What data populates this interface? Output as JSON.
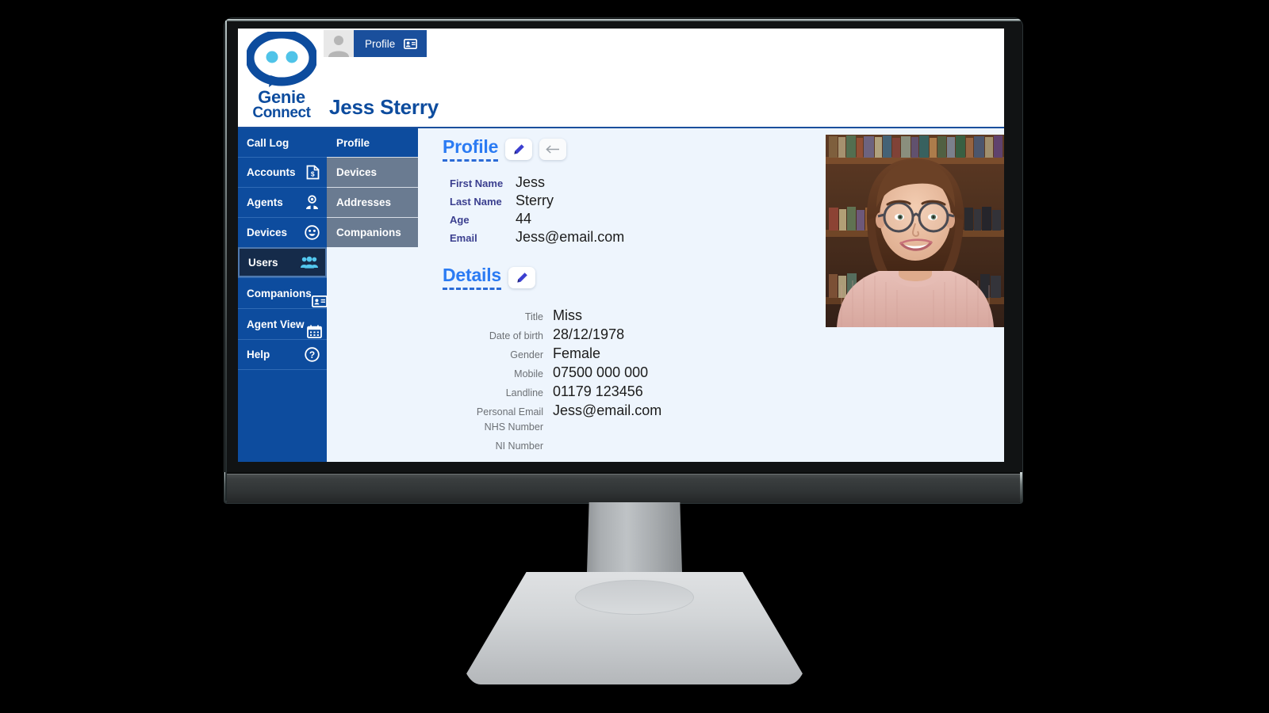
{
  "brand": {
    "logo_line1": "Genie",
    "logo_line2": "Connect",
    "logo_icon": "speech-bubble-icon",
    "primary_color": "#0d4c9e",
    "accent_color": "#2b7bf3",
    "dot_color": "#4fc3e8"
  },
  "header": {
    "avatar_icon": "user-avatar-icon",
    "tab_label": "Profile",
    "tab_icon": "id-card-icon",
    "page_title": "Jess Sterry"
  },
  "nav_primary": {
    "top_label": "Call Log",
    "items": [
      {
        "label": "Accounts",
        "icon": "invoice-icon",
        "active": false
      },
      {
        "label": "Agents",
        "icon": "agent-icon",
        "active": false
      },
      {
        "label": "Devices",
        "icon": "smiley-icon",
        "active": false
      },
      {
        "label": "Users",
        "icon": "users-group-icon",
        "active": true
      },
      {
        "label": "Companions",
        "icon": "id-card-icon",
        "active": false
      },
      {
        "label": "Agent View",
        "icon": "calendar-icon",
        "active": false
      },
      {
        "label": "Help",
        "icon": "question-icon",
        "active": false
      }
    ]
  },
  "nav_secondary": {
    "top_label": "Profile",
    "items": [
      {
        "label": "Devices"
      },
      {
        "label": "Addresses"
      },
      {
        "label": "Companions"
      }
    ]
  },
  "profile_section": {
    "title": "Profile",
    "edit_icon": "pencil-icon",
    "back_icon": "arrow-left-icon",
    "fields": [
      {
        "label": "First Name",
        "value": "Jess"
      },
      {
        "label": "Last Name",
        "value": "Sterry"
      },
      {
        "label": "Age",
        "value": "44"
      },
      {
        "label": "Email",
        "value": "Jess@email.com"
      }
    ]
  },
  "details_section": {
    "title": "Details",
    "edit_icon": "pencil-icon",
    "fields": [
      {
        "label": "Title",
        "value": "Miss"
      },
      {
        "label": "Date of birth",
        "value": "28/12/1978"
      },
      {
        "label": "Gender",
        "value": "Female"
      },
      {
        "label": "Mobile",
        "value": "07500 000 000"
      },
      {
        "label": "Landline",
        "value": "01179 123456"
      },
      {
        "label": "Personal Email",
        "value": "Jess@email.com"
      },
      {
        "label": "NHS Number",
        "value": ""
      },
      {
        "label": "NI Number",
        "value": ""
      }
    ]
  },
  "photo": {
    "alt": "profile-photo-woman-glasses-bookshelf"
  }
}
